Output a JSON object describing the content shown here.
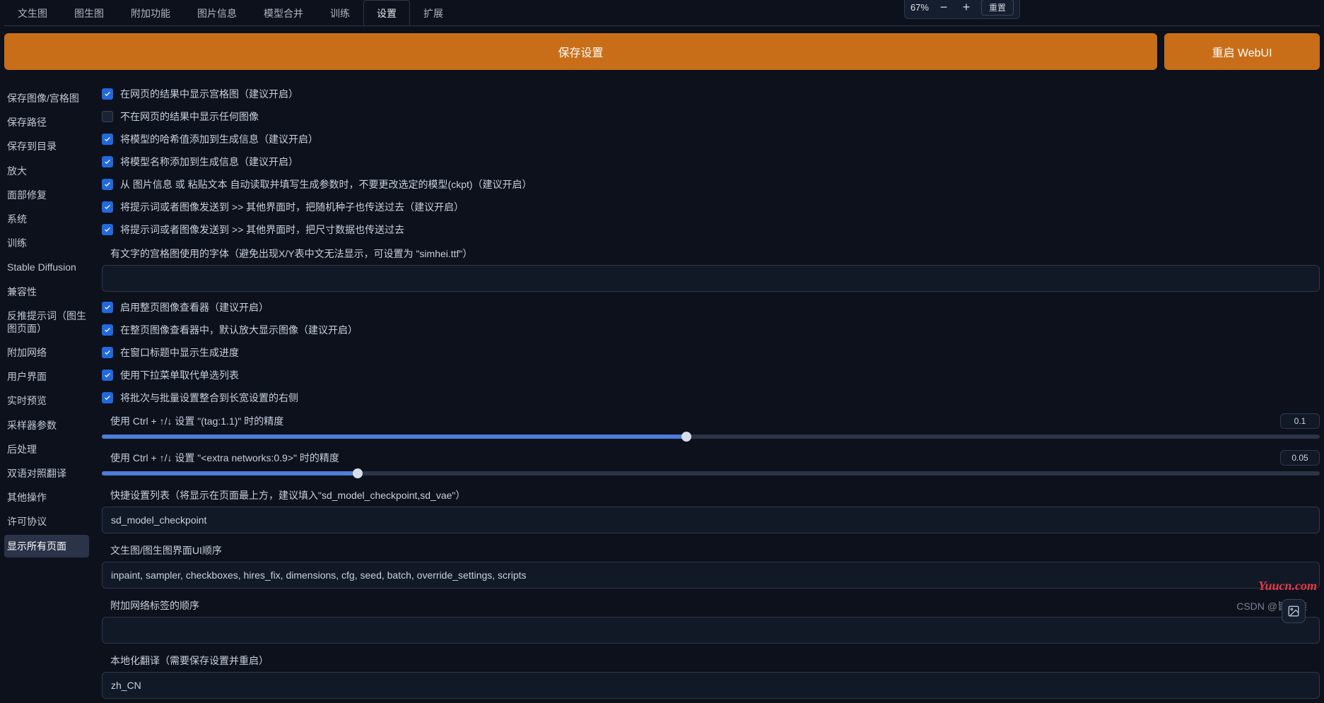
{
  "top_right": {
    "percent": "67%",
    "minus": "−",
    "plus": "+",
    "reset": "重置"
  },
  "tabs": [
    {
      "label": "文生图"
    },
    {
      "label": "图生图"
    },
    {
      "label": "附加功能"
    },
    {
      "label": "图片信息"
    },
    {
      "label": "模型合并"
    },
    {
      "label": "训练"
    },
    {
      "label": "设置",
      "active": true
    },
    {
      "label": "扩展"
    }
  ],
  "actions": {
    "save": "保存设置",
    "restart": "重启 WebUI"
  },
  "sidebar": [
    {
      "label": "保存图像/宫格图"
    },
    {
      "label": "保存路径"
    },
    {
      "label": "保存到目录"
    },
    {
      "label": "放大"
    },
    {
      "label": "面部修复"
    },
    {
      "label": "系统"
    },
    {
      "label": "训练"
    },
    {
      "label": "Stable Diffusion"
    },
    {
      "label": "兼容性"
    },
    {
      "label": "反推提示词（图生图页面）"
    },
    {
      "label": "附加网络"
    },
    {
      "label": "用户界面"
    },
    {
      "label": "实时预览"
    },
    {
      "label": "采样器参数"
    },
    {
      "label": "后处理"
    },
    {
      "label": "双语对照翻译"
    },
    {
      "label": "其他操作"
    },
    {
      "label": "许可协议"
    },
    {
      "label": "显示所有页面",
      "active": true
    }
  ],
  "checks": [
    {
      "on": true,
      "label": "在网页的结果中显示宫格图（建议开启）"
    },
    {
      "on": false,
      "label": "不在网页的结果中显示任何图像"
    },
    {
      "on": true,
      "label": "将模型的哈希值添加到生成信息（建议开启）"
    },
    {
      "on": true,
      "label": "将模型名称添加到生成信息（建议开启）"
    },
    {
      "on": true,
      "label": "从 图片信息 或 粘贴文本 自动读取并填写生成参数时，不要更改选定的模型(ckpt)（建议开启）"
    },
    {
      "on": true,
      "label": "将提示词或者图像发送到 >> 其他界面时，把随机种子也传送过去（建议开启）"
    },
    {
      "on": true,
      "label": "将提示词或者图像发送到 >> 其他界面时，把尺寸数据也传送过去"
    }
  ],
  "font_label": "有文字的宫格图使用的字体（避免出现X/Y表中文无法显示，可设置为 \"simhei.ttf\"）",
  "font_value": "",
  "checks2": [
    {
      "on": true,
      "label": "启用整页图像查看器（建议开启）"
    },
    {
      "on": true,
      "label": "在整页图像查看器中，默认放大显示图像（建议开启）"
    },
    {
      "on": true,
      "label": "在窗口标题中显示生成进度"
    },
    {
      "on": true,
      "label": "使用下拉菜单取代单选列表"
    },
    {
      "on": true,
      "label": "将批次与批量设置整合到长宽设置的右侧"
    }
  ],
  "slider1": {
    "label": "使用 Ctrl + ↑/↓ 设置 \"(tag:1.1)\" 时的精度",
    "value": "0.1",
    "fill_pct": 48
  },
  "slider2": {
    "label": "使用 Ctrl + ↑/↓ 设置 \"<extra networks:0.9>\" 时的精度",
    "value": "0.05",
    "fill_pct": 21
  },
  "quicksettings_label": "快捷设置列表（将显示在页面最上方，建议填入\"sd_model_checkpoint,sd_vae\"）",
  "quicksettings_value": "sd_model_checkpoint",
  "ui_order_label": "文生图/图生图界面UI顺序",
  "ui_order_value": "inpaint, sampler, checkboxes, hires_fix, dimensions, cfg, seed, batch, override_settings, scripts",
  "extra_tabs_label": "附加网络标签的顺序",
  "extra_tabs_value": "",
  "locale_label": "本地化翻译（需要保存设置并重启）",
  "locale_value": "zh_CN",
  "watermark1": "Yuucn.com",
  "watermark2": "CSDN @皆尔蛙"
}
